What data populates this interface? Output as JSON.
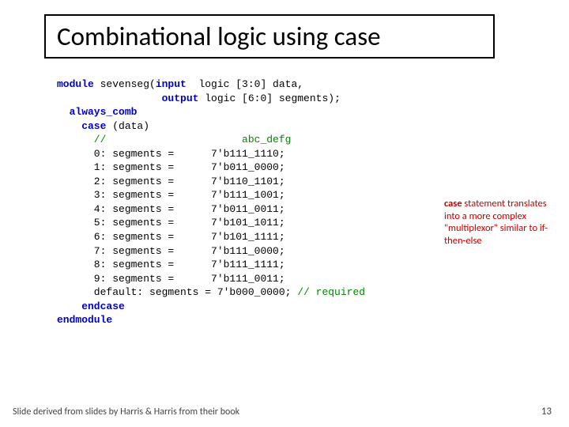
{
  "title": "Combinational logic using case",
  "code": {
    "l1a": "module",
    "l1b": " sevenseg(",
    "l1c": "input",
    "l1d": "  logic [3:0] data,",
    "l2a": "                 output",
    "l2b": " logic [6:0] segments);",
    "l3a": "  always_comb",
    "l4a": "    case",
    "l4b": " (data)",
    "l5a": "      //                      abc_defg",
    "rows": [
      {
        "idx": "      0: segments =      7'b111_1110;"
      },
      {
        "idx": "      1: segments =      7'b011_0000;"
      },
      {
        "idx": "      2: segments =      7'b110_1101;"
      },
      {
        "idx": "      3: segments =      7'b111_1001;"
      },
      {
        "idx": "      4: segments =      7'b011_0011;"
      },
      {
        "idx": "      5: segments =      7'b101_1011;"
      },
      {
        "idx": "      6: segments =      7'b101_1111;"
      },
      {
        "idx": "      7: segments =      7'b111_0000;"
      },
      {
        "idx": "      8: segments =      7'b111_1111;"
      },
      {
        "idx": "      9: segments =      7'b111_0011;"
      }
    ],
    "ldfa": "      default: segments = 7'b000_0000; ",
    "ldfb": "// required",
    "lend1": "    endcase",
    "lend2": "endmodule"
  },
  "annotation": {
    "kw": "case",
    "rest": " statement translates into a more complex \"multiplexor\" similar to if-then-else"
  },
  "footer": {
    "left": "Slide derived from slides by Harris & Harris from their book",
    "right": "13"
  }
}
